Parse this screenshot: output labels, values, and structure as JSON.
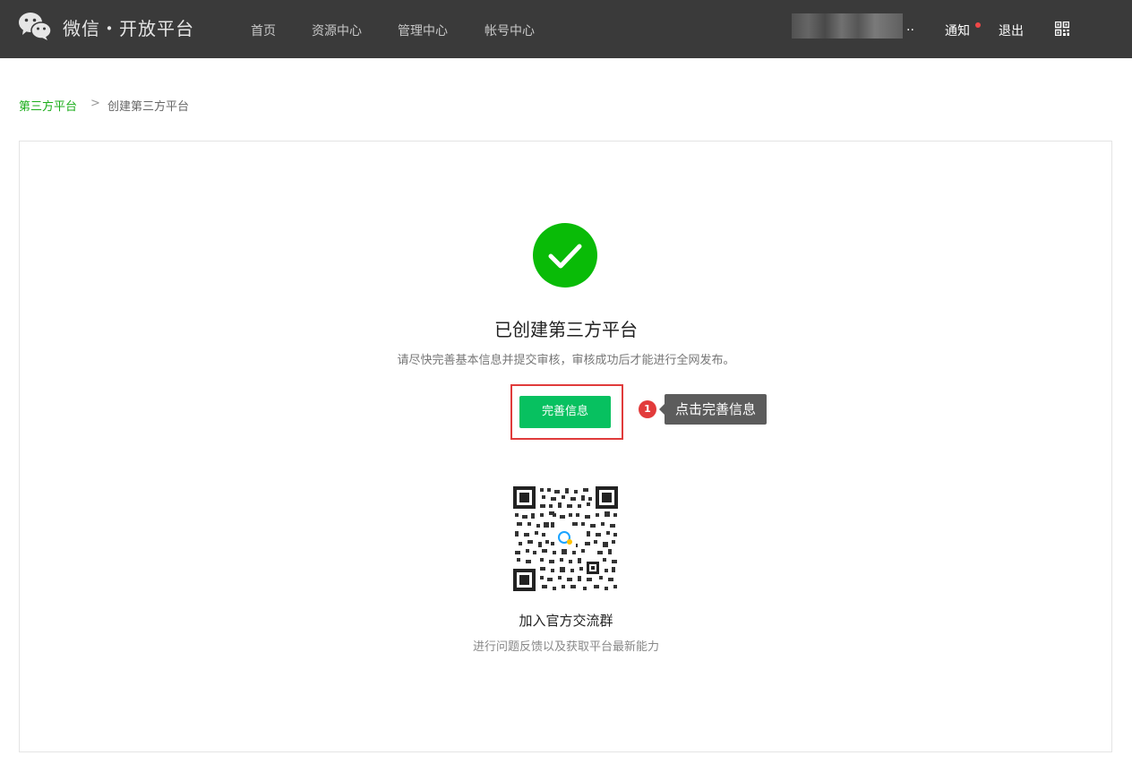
{
  "header": {
    "brand": "微信・开放平台",
    "nav": [
      "首页",
      "资源中心",
      "管理中心",
      "帐号中心"
    ],
    "user_name_masked": "..",
    "notify": "通知",
    "logout": "退出"
  },
  "breadcrumb": {
    "parent": "第三方平台",
    "separator": ">",
    "current": "创建第三方平台"
  },
  "main": {
    "title": "已创建第三方平台",
    "description": "请尽快完善基本信息并提交审核，审核成功后才能进行全网发布。",
    "primary_button": "完善信息",
    "annotation": {
      "step": "1",
      "text": "点击完善信息"
    },
    "qr_title": "加入官方交流群",
    "qr_desc": "进行问题反馈以及获取平台最新能力"
  },
  "colors": {
    "topbar": "#3a3a3a",
    "accent_green": "#07c160",
    "link_green": "#1aad19",
    "highlight_red": "#e03b3b"
  },
  "icons": [
    "wechat-logo-icon",
    "qrcode-icon",
    "success-check-icon",
    "group-qrcode"
  ]
}
